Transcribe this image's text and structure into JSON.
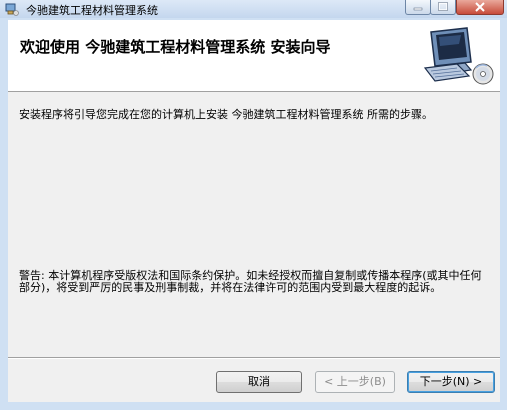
{
  "window": {
    "title": "今驰建筑工程材料管理系统",
    "controls": {
      "minimize_icon": "minimize-icon",
      "maximize_icon": "maximize-icon",
      "close_icon": "close-icon"
    }
  },
  "header": {
    "title": "欢迎使用  今驰建筑工程材料管理系统  安装向导",
    "icon": "computer-disc-icon"
  },
  "body": {
    "instruction": "安装程序将引导您完成在您的计算机上安装 今驰建筑工程材料管理系统 所需的步骤。",
    "warning": "警告: 本计算机程序受版权法和国际条约保护。如未经授权而擅自复制或传播本程序(或其中任何部分)，将受到严厉的民事及刑事制裁，并将在法律许可的范围内受到最大程度的起诉。"
  },
  "buttons": {
    "cancel": "取消",
    "prev": "< 上一步(B)",
    "next": "下一步(N) >"
  },
  "colors": {
    "accent": "#3c7fb1",
    "header_bg": "#ffffff",
    "client_bg": "#f0f0f0",
    "close_red": "#c74b3a"
  }
}
